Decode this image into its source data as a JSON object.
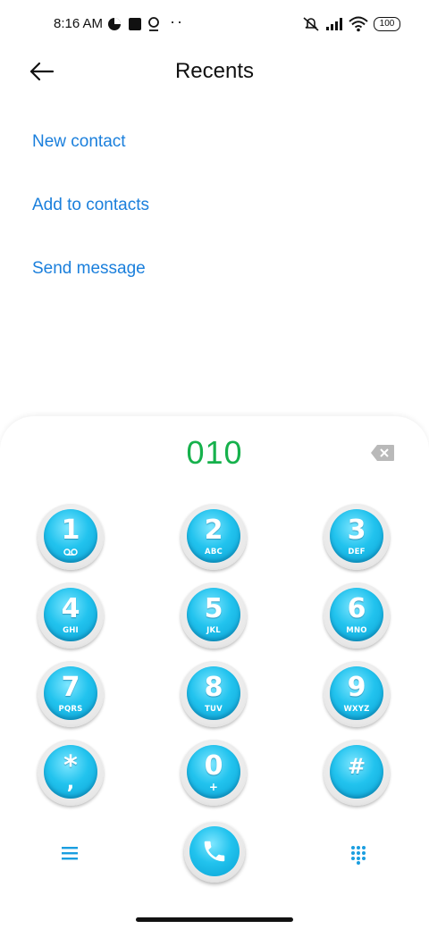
{
  "status_bar": {
    "time": "8:16 AM",
    "battery": "100",
    "icons": [
      "notification-icon",
      "square-icon",
      "location-icon",
      "more-dots-icon",
      "mute-icon",
      "signal-icon",
      "wifi-icon",
      "battery-icon"
    ]
  },
  "header": {
    "title": "Recents",
    "back_icon": "arrow-left-icon"
  },
  "actions": [
    {
      "label": "New contact"
    },
    {
      "label": "Add to contacts"
    },
    {
      "label": "Send message"
    }
  ],
  "dialer": {
    "number": "010",
    "number_color": "#16b14c",
    "backspace_icon": "backspace-icon",
    "keys": [
      {
        "digit": "1",
        "letters": "",
        "icon": "voicemail-icon"
      },
      {
        "digit": "2",
        "letters": "ABC"
      },
      {
        "digit": "3",
        "letters": "DEF"
      },
      {
        "digit": "4",
        "letters": "GHI"
      },
      {
        "digit": "5",
        "letters": "JKL"
      },
      {
        "digit": "6",
        "letters": "MNO"
      },
      {
        "digit": "7",
        "letters": "PQRS"
      },
      {
        "digit": "8",
        "letters": "TUV"
      },
      {
        "digit": "9",
        "letters": "WXYZ"
      },
      {
        "digit": "*",
        "letters": ","
      },
      {
        "digit": "0",
        "letters": "+"
      },
      {
        "digit": "#",
        "letters": ""
      }
    ],
    "bottom": {
      "menu_icon": "menu-icon",
      "call_icon": "phone-icon",
      "keypad_icon": "dialpad-icon"
    }
  },
  "colors": {
    "accent": "#1a7fdc",
    "key_blue": "#22c3ee"
  }
}
